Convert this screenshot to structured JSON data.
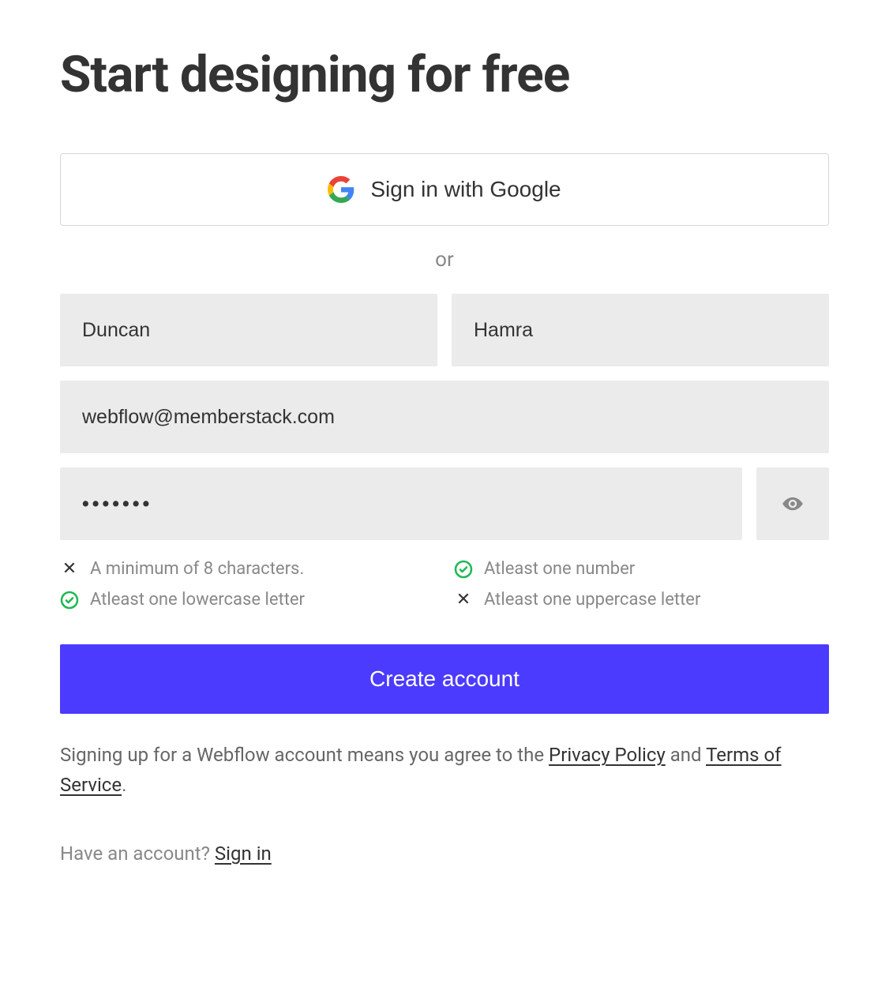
{
  "title": "Start designing for free",
  "google": {
    "label": "Sign in with Google"
  },
  "or": "or",
  "form": {
    "first_name": "Duncan",
    "last_name": "Hamra",
    "email": "webflow@memberstack.com",
    "password": "•••••••"
  },
  "rules": {
    "min8": {
      "label": "A minimum of 8 characters.",
      "pass": false
    },
    "number": {
      "label": "Atleast one number",
      "pass": true
    },
    "lower": {
      "label": "Atleast one lowercase letter",
      "pass": true
    },
    "upper": {
      "label": "Atleast one uppercase letter",
      "pass": false
    }
  },
  "submit": "Create account",
  "agree": {
    "prefix": "Signing up for a Webflow account means you agree to the ",
    "privacy": "Privacy Policy",
    "and": " and ",
    "terms": "Terms of Service",
    "suffix": "."
  },
  "haveacct": {
    "prefix": "Have an account? ",
    "signin": "Sign in"
  }
}
